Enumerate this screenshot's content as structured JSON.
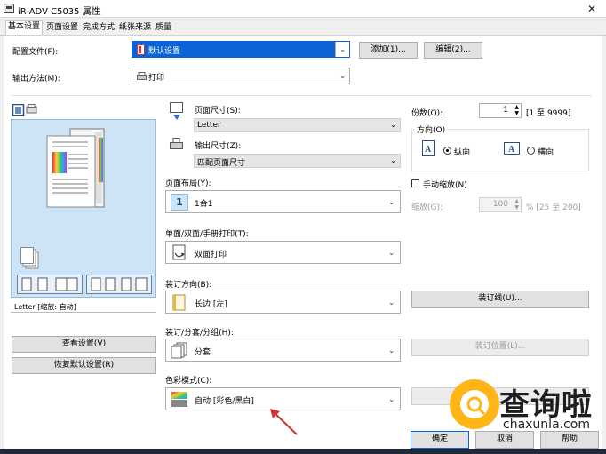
{
  "window": {
    "title": "iR-ADV C5035 属性",
    "close_glyph": "✕"
  },
  "tabs": [
    "基本设置",
    "页面设置",
    "完成方式",
    "纸张来源",
    "质量"
  ],
  "profile": {
    "label": "配置文件(F):",
    "value": "默认设置",
    "add_button": "添加(1)...",
    "edit_button": "编辑(2)..."
  },
  "output_method": {
    "label": "输出方法(M):",
    "value": "打印"
  },
  "preview": {
    "caption": "Letter [缩放: 自动]"
  },
  "left_buttons": {
    "view_settings": "查看设置(V)",
    "restore_defaults": "恢复默认设置(R)"
  },
  "page_size": {
    "label": "页面尺寸(S):",
    "value": "Letter"
  },
  "output_size": {
    "label": "输出尺寸(Z):",
    "value": "匹配页面尺寸"
  },
  "layout": {
    "label": "页面布局(Y):",
    "value": "1合1",
    "number": "1"
  },
  "duplex": {
    "label": "单面/双面/手册打印(T):",
    "value": "双面打印"
  },
  "binding": {
    "label": "装订方向(B):",
    "value": "长边 [左]",
    "button": "装订线(U)..."
  },
  "collate": {
    "label": "装订/分套/分组(H):",
    "value": "分套",
    "button": "装订位置(L)..."
  },
  "color_mode": {
    "label": "色彩模式(C):",
    "value": "自动 [彩色/黑白]"
  },
  "copies": {
    "label": "份数(Q):",
    "value": "1",
    "range": "[1 至 9999]"
  },
  "orientation": {
    "label": "方向(O)",
    "portrait": "纵向",
    "landscape": "横向",
    "selected": "portrait"
  },
  "manual_scale": {
    "label": "手动缩放(N)",
    "checked": false,
    "scale_label": "缩放(G):",
    "scale_value": "100",
    "scale_range": "% [25 至 200]"
  },
  "footer": {
    "ok": "确定",
    "cancel": "取消",
    "help": "帮助"
  },
  "watermark": {
    "brand": "查询啦",
    "url": "chaxunla.com"
  },
  "colors": {
    "accent": "#ffb515",
    "preview_bg": "#cde4f7",
    "arrow": "#d03030"
  }
}
